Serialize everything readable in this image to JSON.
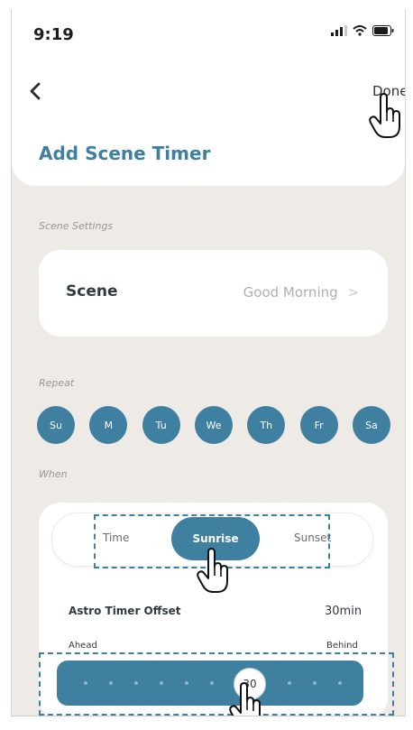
{
  "status_bar": {
    "time": "9:19"
  },
  "header": {
    "back_icon": "chevron-left-icon",
    "done_label": "Done",
    "title": "Add Scene Timer"
  },
  "scene_settings": {
    "section_label": "Scene Settings",
    "scene_label": "Scene",
    "scene_value": "Good Morning",
    "chevron": ">"
  },
  "repeat": {
    "section_label": "Repeat",
    "days": [
      "Su",
      "M",
      "Tu",
      "We",
      "Th",
      "Fr",
      "Sa"
    ]
  },
  "when": {
    "section_label": "When",
    "options": [
      "Time",
      "Sunrise",
      "Sunset"
    ],
    "selected": "Sunrise",
    "offset_label": "Astro Timer Offset",
    "offset_value": "30min",
    "ahead_label": "Ahead",
    "behind_label": "Behind",
    "slider_value": "30"
  },
  "colors": {
    "accent": "#3f7fa0",
    "background": "#eeeae5",
    "card": "#ffffff"
  }
}
